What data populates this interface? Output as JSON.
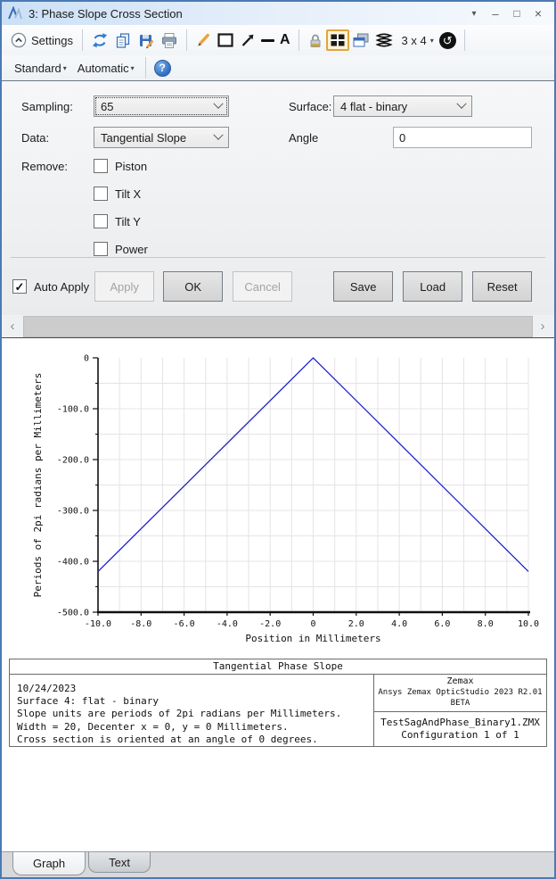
{
  "window": {
    "title": "3: Phase Slope Cross Section"
  },
  "icons": {
    "dropdown_caret": "▾",
    "minimize": "–",
    "maximize": "□",
    "close": "×",
    "help": "?",
    "history": "↺",
    "check": "✓",
    "scroll_left": "‹",
    "scroll_right": "›",
    "text_tool": "A"
  },
  "toolbar": {
    "settings_label": "Settings",
    "grid_label": "3 x 4",
    "standard_label": "Standard",
    "automatic_label": "Automatic"
  },
  "settings": {
    "sampling_label": "Sampling:",
    "sampling_value": "65",
    "surface_label": "Surface:",
    "surface_value": "4 flat - binary",
    "data_label": "Data:",
    "data_value": "Tangential Slope",
    "angle_label": "Angle",
    "angle_value": "0",
    "remove_label": "Remove:",
    "checkboxes": [
      {
        "label": "Piston",
        "checked": false
      },
      {
        "label": "Tilt X",
        "checked": false
      },
      {
        "label": "Tilt Y",
        "checked": false
      },
      {
        "label": "Power",
        "checked": false
      }
    ],
    "auto_apply": {
      "label": "Auto Apply",
      "checked": true
    },
    "buttons": [
      {
        "label": "Apply",
        "enabled": false
      },
      {
        "label": "OK",
        "enabled": true
      },
      {
        "label": "Cancel",
        "enabled": false
      },
      {
        "label": "Save",
        "enabled": true
      },
      {
        "label": "Load",
        "enabled": true
      },
      {
        "label": "Reset",
        "enabled": true
      }
    ]
  },
  "chart_data": {
    "type": "line",
    "title": "Tangential Phase Slope",
    "xlabel": "Position in Millimeters",
    "ylabel": "Periods of 2pi radians per Millimeters",
    "xlim": [
      -10,
      10
    ],
    "ylim": [
      -500,
      0
    ],
    "xticks": [
      -10,
      -8,
      -6,
      -4,
      -2,
      0,
      2,
      4,
      6,
      8,
      10
    ],
    "xtick_labels": [
      "-10.0",
      "-8.0",
      "-6.0",
      "-4.0",
      "-2.0",
      "0",
      "2.0",
      "4.0",
      "6.0",
      "8.0",
      "10.0"
    ],
    "yticks": [
      0,
      -100,
      -200,
      -300,
      -400,
      -500
    ],
    "ytick_labels": [
      "0",
      "-100.0",
      "-200.0",
      "-300.0",
      "-400.0",
      "-500.0"
    ],
    "x_minor_step": 1,
    "y_minor_step": 50,
    "grid": true,
    "legend": "none",
    "line_color": "#2323cc",
    "series": [
      {
        "name": "Tangential Phase Slope",
        "points": [
          [
            -10,
            -420
          ],
          [
            0,
            0
          ],
          [
            10,
            -420
          ]
        ]
      }
    ]
  },
  "footer": {
    "title": "Tangential Phase Slope",
    "left_lines": [
      "10/24/2023",
      "Surface 4: flat - binary",
      "Slope units are periods of 2pi radians per Millimeters.",
      "Width = 20, Decenter x = 0, y = 0 Millimeters.",
      "Cross section is oriented at an angle of 0 degrees."
    ],
    "right_top": [
      "Zemax",
      "Ansys Zemax OpticStudio 2023 R2.01 BETA"
    ],
    "right_bottom": [
      "TestSagAndPhase_Binary1.ZMX",
      "Configuration 1 of 1"
    ]
  },
  "tabs": [
    {
      "label": "Graph",
      "active": true
    },
    {
      "label": "Text",
      "active": false
    }
  ]
}
